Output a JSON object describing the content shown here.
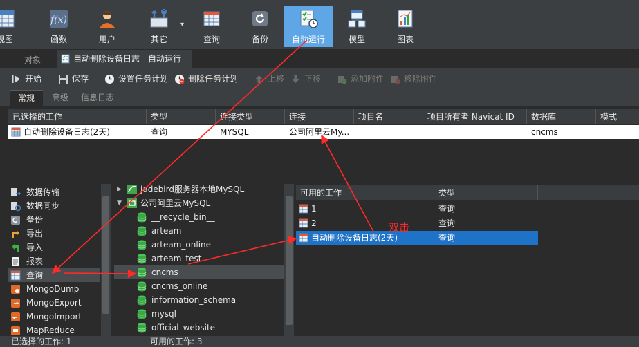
{
  "ribbon": {
    "items": [
      {
        "label": "视图",
        "icon": "grid-view-icon"
      },
      {
        "label": "函数",
        "icon": "function-icon"
      },
      {
        "label": "用户",
        "icon": "user-icon"
      },
      {
        "label": "其它",
        "icon": "tools-icon"
      },
      {
        "label": "查询",
        "icon": "query-table-icon"
      },
      {
        "label": "备份",
        "icon": "backup-icon"
      },
      {
        "label": "自动运行",
        "icon": "automation-icon",
        "active": true
      },
      {
        "label": "模型",
        "icon": "model-icon"
      },
      {
        "label": "图表",
        "icon": "chart-icon"
      }
    ],
    "dropdown_glyph": "▾"
  },
  "tabs": {
    "objects": "对象",
    "document": "自动删除设备日志 - 自动运行"
  },
  "toolbar": {
    "start": "开始",
    "save": "保存",
    "schedule": "设置任务计划",
    "delete_schedule": "删除任务计划",
    "move_up": "上移",
    "move_down": "下移",
    "add_attachment": "添加附件",
    "remove_attachment": "移除附件"
  },
  "subtabs": [
    "常规",
    "高级",
    "信息日志"
  ],
  "selected_jobs": {
    "columns": [
      "已选择的工作",
      "类型",
      "连接类型",
      "连接",
      "项目名",
      "项目所有者 Navicat ID",
      "数据库",
      "模式"
    ],
    "rows": [
      [
        "自动删除设备日志(2天)",
        "查询",
        "MYSQL",
        "公司阿里云My...",
        "",
        "",
        "cncms",
        ""
      ]
    ]
  },
  "categories": [
    {
      "label": "数据传输",
      "icon": "data-transfer-icon"
    },
    {
      "label": "数据同步",
      "icon": "data-sync-icon"
    },
    {
      "label": "备份",
      "icon": "backup-icon"
    },
    {
      "label": "导出",
      "icon": "export-icon"
    },
    {
      "label": "导入",
      "icon": "import-icon"
    },
    {
      "label": "报表",
      "icon": "report-icon"
    },
    {
      "label": "查询",
      "icon": "query-table-icon",
      "active": true
    },
    {
      "label": "MongoDump",
      "icon": "mongodump-icon"
    },
    {
      "label": "MongoExport",
      "icon": "mongoexport-icon"
    },
    {
      "label": "MongoImport",
      "icon": "mongoimport-icon"
    },
    {
      "label": "MapReduce",
      "icon": "mapreduce-icon"
    }
  ],
  "tree": {
    "connections": [
      {
        "label": "jadebird服务器本地MySQL",
        "expanded": false
      },
      {
        "label": "公司阿里云MySQL",
        "expanded": true
      }
    ],
    "databases": [
      "__recycle_bin__",
      "arteam",
      "arteam_online",
      "arteam_test",
      "cncms",
      "cncms_online",
      "information_schema",
      "mysql",
      "official_website"
    ],
    "active_database": "cncms"
  },
  "available_jobs": {
    "columns": [
      "可用的工作",
      "类型"
    ],
    "rows": [
      {
        "name": "1",
        "type": "查询"
      },
      {
        "name": "2",
        "type": "查询"
      },
      {
        "name": "自动删除设备日志(2天)",
        "type": "查询",
        "active": true
      }
    ]
  },
  "annotation": {
    "text": "双击",
    "color": "#ff2a2a"
  },
  "status": {
    "selected_count": "已选择的工作: 1",
    "available_count": "可用的工作: 3"
  },
  "colors": {
    "accent": "#5ea6e6",
    "selection": "#1e72c7",
    "background": "#2b2b2b",
    "panel": "#3c3f41"
  }
}
